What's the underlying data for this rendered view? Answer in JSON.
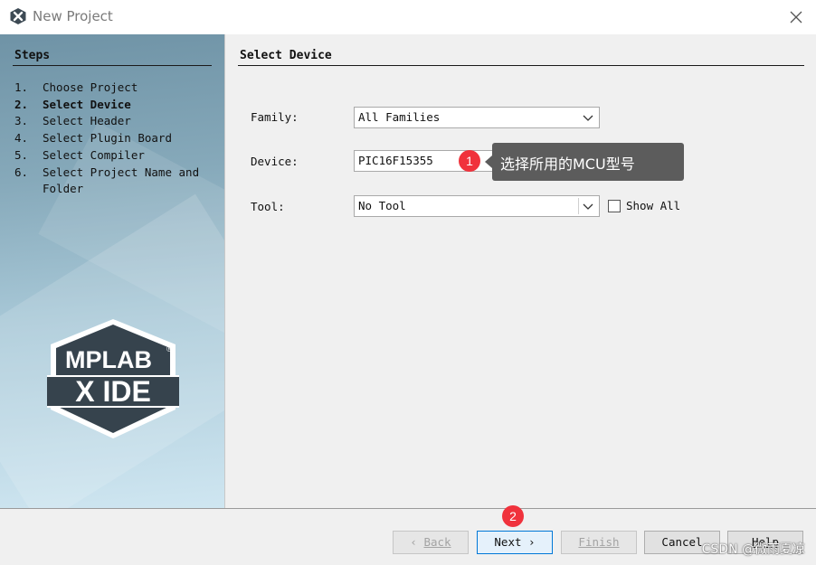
{
  "window": {
    "title": "New Project",
    "close_icon": "close-icon",
    "app_icon": "mplab-x-icon"
  },
  "steps": {
    "title": "Steps",
    "items": [
      {
        "num": "1.",
        "label": "Choose Project"
      },
      {
        "num": "2.",
        "label": "Select Device",
        "active": true
      },
      {
        "num": "3.",
        "label": "Select Header"
      },
      {
        "num": "4.",
        "label": "Select Plugin Board"
      },
      {
        "num": "5.",
        "label": "Select Compiler"
      },
      {
        "num": "6.",
        "label": "Select Project Name and Folder"
      }
    ]
  },
  "logo": {
    "line1": "MPLAB",
    "registered": "®",
    "line2": "X IDE"
  },
  "main": {
    "title": "Select Device",
    "family": {
      "label": "Family:",
      "value": "All Families"
    },
    "device": {
      "label": "Device:",
      "value": "PIC16F15355"
    },
    "tool": {
      "label": "Tool:",
      "value": "No Tool",
      "show_all_label": "Show All",
      "show_all_checked": false
    }
  },
  "annotations": {
    "badge1": "1",
    "badge2": "2",
    "callout": "选择所用的MCU型号",
    "badge_color": "#f0323c"
  },
  "buttons": {
    "back": {
      "prefix": "‹ ",
      "label": "Back"
    },
    "next": {
      "label": "Next",
      "suffix": " ›"
    },
    "finish": {
      "label": "Finish"
    },
    "cancel": {
      "label": "Cancel"
    },
    "help": {
      "label": "Help"
    }
  },
  "watermark": "CSDN @微雨夏凉"
}
